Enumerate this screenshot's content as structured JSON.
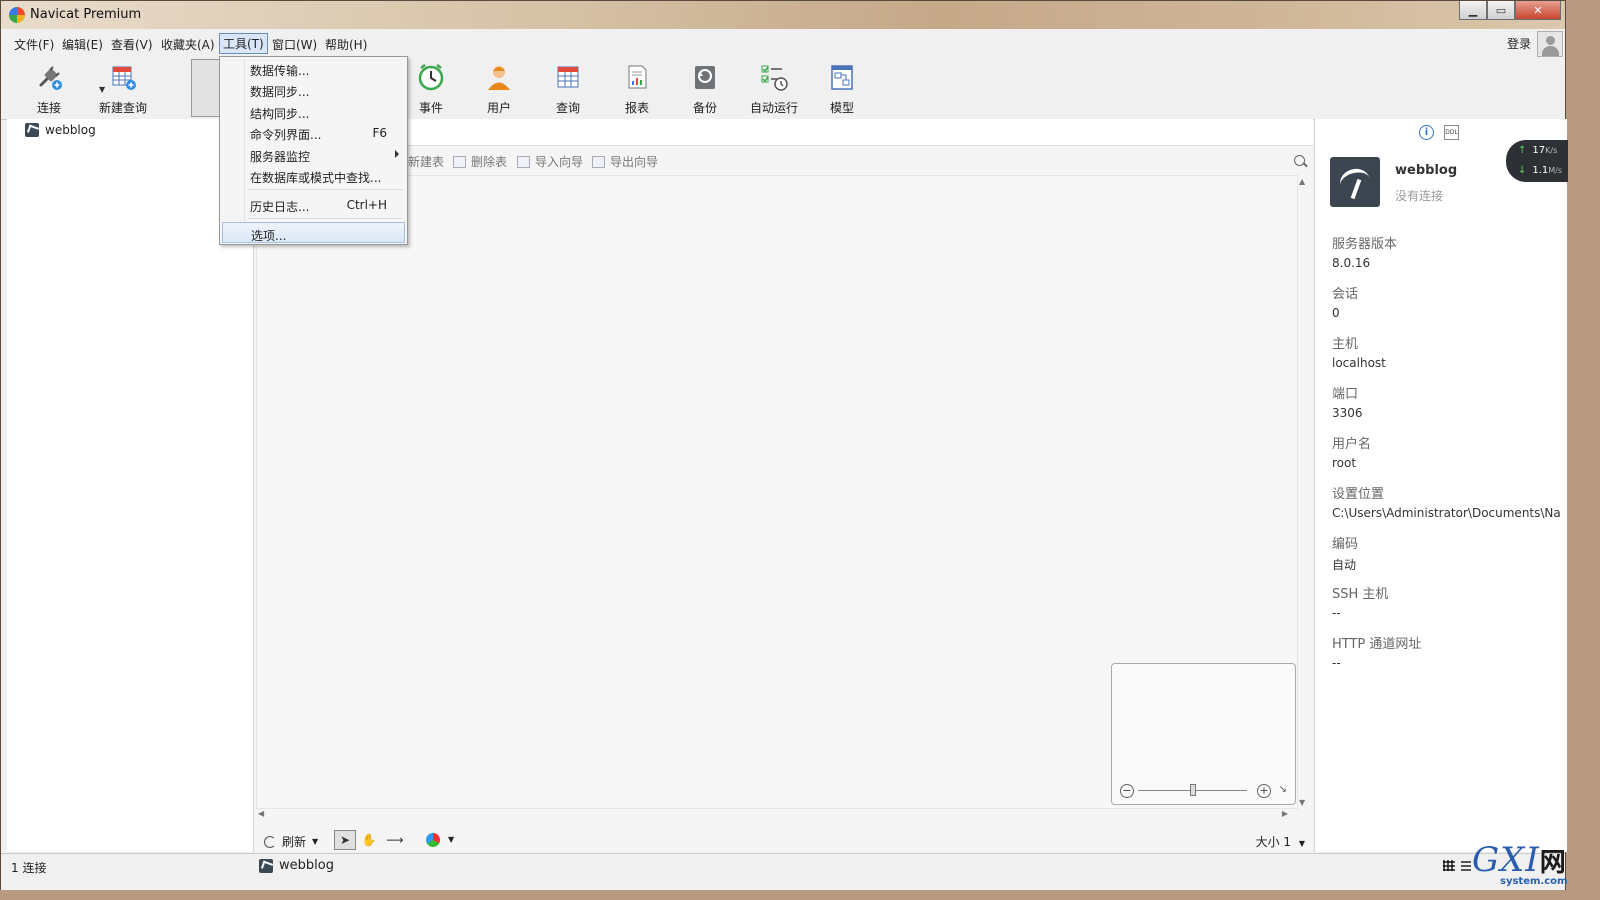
{
  "window": {
    "title": "Navicat Premium"
  },
  "menubar": {
    "items": [
      "文件(F)",
      "编辑(E)",
      "查看(V)",
      "收藏夹(A)",
      "工具(T)",
      "窗口(W)",
      "帮助(H)"
    ],
    "login": "登录"
  },
  "toolbar": {
    "connect": "连接",
    "new_query": "新建查询",
    "event": "事件",
    "user": "用户",
    "query": "查询",
    "report": "报表",
    "backup": "备份",
    "automation": "自动运行",
    "model": "模型"
  },
  "tools_menu": {
    "items": [
      {
        "label": "数据传输...",
        "shortcut": ""
      },
      {
        "label": "数据同步...",
        "shortcut": ""
      },
      {
        "label": "结构同步...",
        "shortcut": ""
      },
      {
        "label": "命令列界面...",
        "shortcut": "F6"
      },
      {
        "label": "服务器监控",
        "shortcut": ""
      },
      {
        "label": "在数据库或模式中查找...",
        "shortcut": ""
      },
      {
        "label": "历史日志...",
        "shortcut": "Ctrl+H"
      },
      {
        "label": "选项...",
        "shortcut": ""
      }
    ]
  },
  "navigator": {
    "connection": "webblog"
  },
  "object_toolbar": {
    "new_table": "新建表",
    "delete_table": "删除表",
    "import_wizard": "导入向导",
    "export_wizard": "导出向导"
  },
  "canvas_tools": {
    "refresh": "刷新",
    "size": "大小 1"
  },
  "info_panel": {
    "name": "webblog",
    "status": "没有连接",
    "properties": [
      {
        "key": "服务器版本",
        "value": "8.0.16"
      },
      {
        "key": "会话",
        "value": "0"
      },
      {
        "key": "主机",
        "value": "localhost"
      },
      {
        "key": "端口",
        "value": "3306"
      },
      {
        "key": "用户名",
        "value": "root"
      },
      {
        "key": "设置位置",
        "value": "C:\\Users\\Administrator\\Documents\\Na"
      },
      {
        "key": "编码",
        "value": "自动"
      },
      {
        "key": "SSH 主机",
        "value": "--"
      },
      {
        "key": "HTTP 通道网址",
        "value": "--"
      }
    ]
  },
  "statusbar": {
    "connections": "1 连接",
    "current": "webblog"
  },
  "speed_widget": {
    "up": "17",
    "up_unit": "K/s",
    "down": "1.1",
    "down_unit": "M/s"
  },
  "watermark": {
    "brand": "GXI",
    "brand_cn": "网",
    "site": "system.com"
  },
  "colors": {
    "accent": "#2f74c0",
    "menu_highlight": "#dbe7f7"
  }
}
